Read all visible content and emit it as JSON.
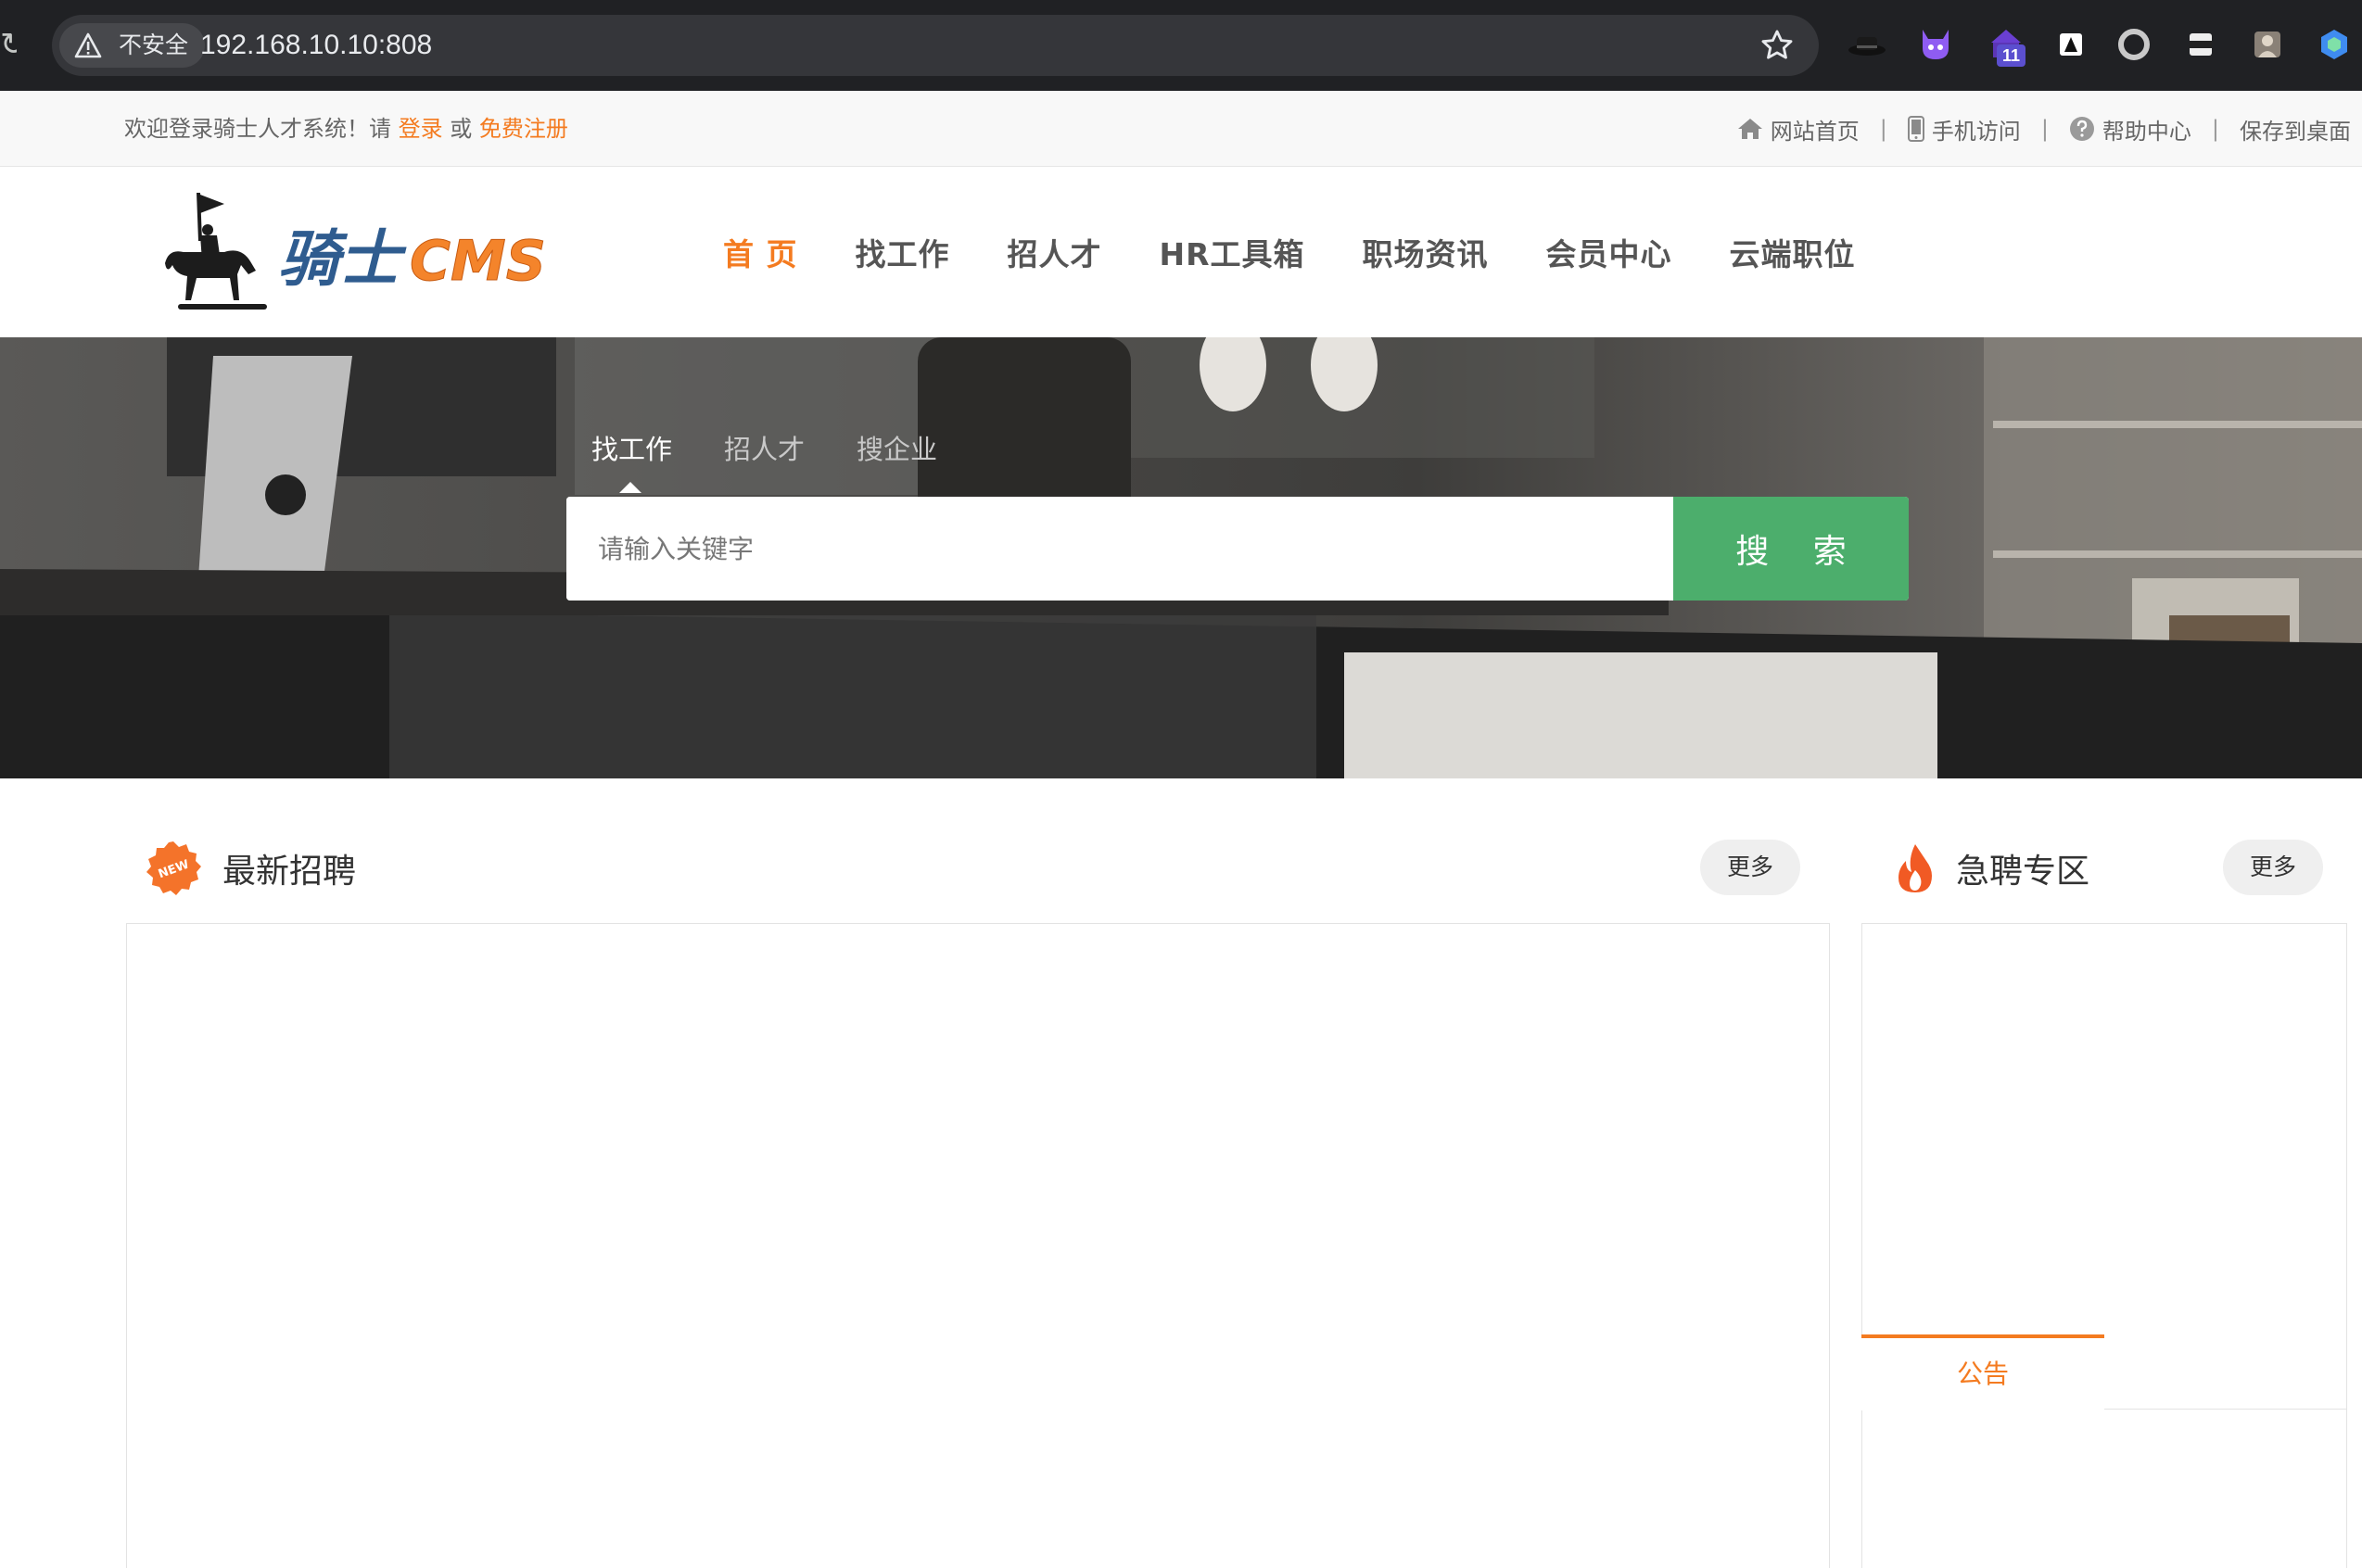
{
  "browser": {
    "security_label": "不安全",
    "url": "192.168.10.10:808",
    "extension_badge": "11"
  },
  "topbar": {
    "welcome_prefix": "欢迎登录骑士人才系统！请 ",
    "login": "登录",
    "or": " 或 ",
    "register": "免费注册",
    "links": [
      "网站首页",
      "手机访问",
      "帮助中心",
      "保存到桌面"
    ],
    "separator": "|"
  },
  "nav": {
    "items": [
      "首 页",
      "找工作",
      "招人才",
      "HR工具箱",
      "职场资讯",
      "会员中心",
      "云端职位"
    ],
    "active_index": 0
  },
  "search": {
    "tabs": [
      "找工作",
      "招人才",
      "搜企业"
    ],
    "active_tab": 0,
    "placeholder": "请输入关键字",
    "button": "搜 索"
  },
  "sections": {
    "latest": {
      "title": "最新招聘",
      "more": "更多",
      "badge": "NEW"
    },
    "urgent": {
      "title": "急聘专区",
      "more": "更多"
    },
    "notice_tab": "公告"
  },
  "colors": {
    "accent": "#f47b20",
    "search_button": "#4cae6c",
    "chrome_bg": "#202124"
  }
}
